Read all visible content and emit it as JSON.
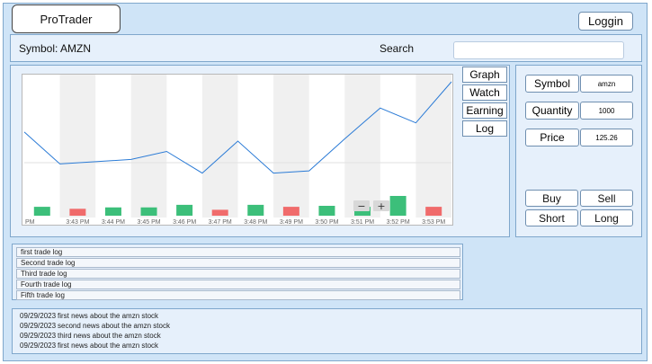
{
  "header": {
    "brand": "ProTrader",
    "login_label": "Loggin"
  },
  "toolbar": {
    "symbol_text": "Symbol: AMZN",
    "search_label": "Search",
    "search_value": "",
    "search_placeholder": ""
  },
  "tabs": [
    {
      "label": "Graph"
    },
    {
      "label": "Watch"
    },
    {
      "label": "Earning"
    },
    {
      "label": "Log"
    }
  ],
  "order_form": {
    "symbol_label": "Symbol",
    "symbol_value": "amzn",
    "quantity_label": "Quantity",
    "quantity_value": "1000",
    "price_label": "Price",
    "price_value": "125.26",
    "buy_label": "Buy",
    "sell_label": "Sell",
    "short_label": "Short",
    "long_label": "Long"
  },
  "chart_controls": {
    "zoom_out": "−",
    "zoom_in": "+"
  },
  "chart_data": {
    "type": "line",
    "x": [
      "PM",
      "3:43 PM",
      "3:44 PM",
      "3:45 PM",
      "3:46 PM",
      "3:47 PM",
      "3:48 PM",
      "3:49 PM",
      "3:50 PM",
      "3:51 PM",
      "3:52 PM",
      "3:53 PM"
    ],
    "series": [
      {
        "values": [
          0.56,
          0.28,
          0.3,
          0.32,
          0.39,
          0.2,
          0.48,
          0.2,
          0.22,
          0.5,
          0.77,
          0.64,
          1.0
        ]
      }
    ],
    "volume": [
      {
        "value": 0.45,
        "direction": "up"
      },
      {
        "value": 0.35,
        "direction": "down"
      },
      {
        "value": 0.42,
        "direction": "up"
      },
      {
        "value": 0.42,
        "direction": "up"
      },
      {
        "value": 0.55,
        "direction": "up"
      },
      {
        "value": 0.3,
        "direction": "down"
      },
      {
        "value": 0.55,
        "direction": "up"
      },
      {
        "value": 0.45,
        "direction": "down"
      },
      {
        "value": 0.5,
        "direction": "up"
      },
      {
        "value": 0.45,
        "direction": "up"
      },
      {
        "value": 1.0,
        "direction": "up"
      },
      {
        "value": 0.45,
        "direction": "down"
      }
    ],
    "colors": {
      "line": "#2b7bd6",
      "up": "#3cbf7a",
      "down": "#f06b6b",
      "band": "#f0f0f0"
    },
    "grid": false
  },
  "trade_log": [
    "first trade log",
    "Second trade log",
    "Third trade log",
    "Fourth trade log",
    "Fifth trade log"
  ],
  "news": [
    {
      "date": "09/29/2023",
      "text": "first news about the amzn stock"
    },
    {
      "date": "09/29/2023",
      "text": "second news about the amzn stock"
    },
    {
      "date": "09/29/2023",
      "text": "third news about the amzn stock"
    },
    {
      "date": "09/29/2023",
      "text": "first news about the amzn stock"
    }
  ]
}
